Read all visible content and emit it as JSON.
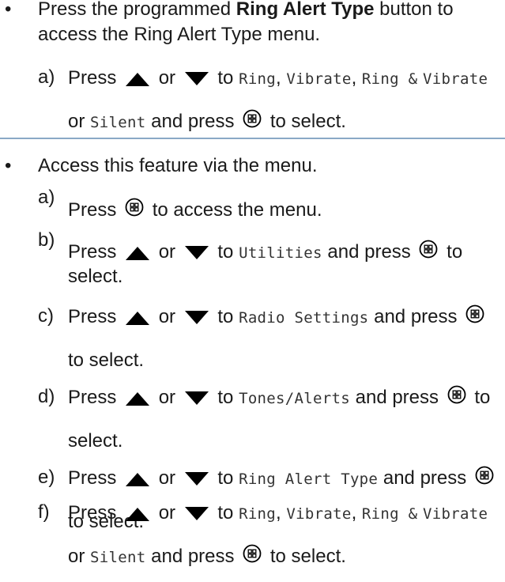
{
  "section1": {
    "bullet": "•",
    "intro_pre": "Press the programmed ",
    "intro_bold": "Ring Alert Type",
    "intro_post": " button to access the Ring Alert Type menu.",
    "step": {
      "marker": "a)",
      "press": "Press",
      "or": "or",
      "to": "to",
      "opt1": "Ring",
      "comma1": ", ",
      "opt2": "Vibrate",
      "comma2": ", ",
      "opt3a": "Ring &",
      "opt3b": "Vibrate",
      "or2": "or",
      "opt4": "Silent",
      "and_press": "and press",
      "to_select": "to select."
    }
  },
  "section2": {
    "bullet": "•",
    "intro": "Access this feature via the menu.",
    "steps": {
      "a": {
        "marker": "a)",
        "press": "Press",
        "rest": "to access the menu."
      },
      "b": {
        "marker": "b)",
        "press": "Press",
        "or": "or",
        "to": "to",
        "target": "Utilities",
        "and_press": "and press",
        "to_select": "to select."
      },
      "c": {
        "marker": "c)",
        "press": "Press",
        "or": "or",
        "to": "to",
        "target": "Radio Settings",
        "and": "and",
        "press2": "press",
        "to_select": "to select."
      },
      "d": {
        "marker": "d)",
        "press": "Press",
        "or": "or",
        "to": "to",
        "target": "Tones/Alerts",
        "and_press": "and press",
        "to_select": "to select."
      },
      "e": {
        "marker": "e)",
        "press": "Press",
        "or": "or",
        "to": "to",
        "target": "Ring Alert Type",
        "and": "and",
        "press2": "press",
        "to_select": "to select."
      },
      "f": {
        "marker": "f)",
        "press": "Press",
        "or": "or",
        "to": "to",
        "opt1": "Ring",
        "comma1": ", ",
        "opt2": "Vibrate",
        "comma2": ", ",
        "opt3a": "Ring &",
        "opt3b": "Vibrate",
        "or2": "or",
        "opt4": "Silent",
        "and_press": "and press",
        "to_select": "to select."
      }
    }
  },
  "icons": {
    "up": "up-arrow-icon",
    "down": "down-arrow-icon",
    "menu_ok": "menu-ok-button-icon"
  }
}
